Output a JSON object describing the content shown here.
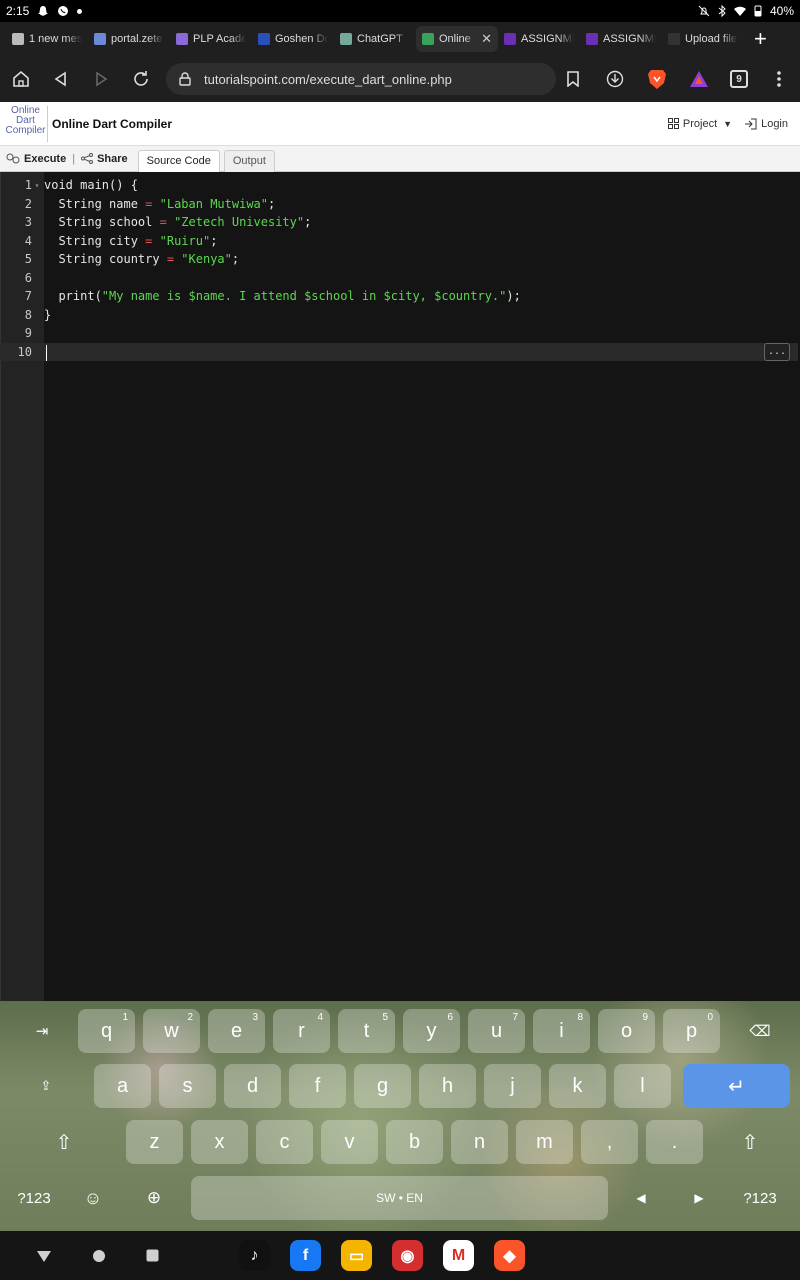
{
  "status_bar": {
    "time": "2:15",
    "battery": "40%"
  },
  "tabs": [
    {
      "title": "1 new mes",
      "fav_color": "#bbbbbb"
    },
    {
      "title": "portal.zete",
      "fav_color": "#6a8ad8"
    },
    {
      "title": "PLP Acade",
      "fav_color": "#8a6ad8"
    },
    {
      "title": "Goshen De",
      "fav_color": "#2b4fb8"
    },
    {
      "title": "ChatGPT",
      "fav_color": "#74aa9c"
    },
    {
      "title": "Online",
      "fav_color": "#3aa35a",
      "active": true
    },
    {
      "title": "ASSIGNME",
      "fav_color": "#6b2fb3"
    },
    {
      "title": "ASSIGNME",
      "fav_color": "#6b2fb3"
    },
    {
      "title": "Upload file",
      "fav_color": "#333333"
    }
  ],
  "toolbar": {
    "url": "tutorialspoint.com/execute_dart_online.php",
    "tab_count": "9"
  },
  "site": {
    "logo_alt": "Online Dart Compiler",
    "title": "Online Dart Compiler",
    "project_label": "Project",
    "login_label": "Login"
  },
  "editor_toolbar": {
    "execute_label": "Execute",
    "share_label": "Share",
    "source_code_tab": "Source Code",
    "output_tab": "Output"
  },
  "code": {
    "lines": [
      "void main() {",
      "  String name = \"Laban Mutwiwa\";",
      "  String school = \"Zetech Univesity\";",
      "  String city = \"Ruiru\";",
      "  String country = \"Kenya\";",
      "",
      "  print(\"My name is $name. I attend $school in $city, $country.\");",
      "}",
      "",
      ""
    ],
    "current_line": 10,
    "more_button": "..."
  },
  "keyboard": {
    "row1": [
      {
        "k": "q",
        "n": "1"
      },
      {
        "k": "w",
        "n": "2"
      },
      {
        "k": "e",
        "n": "3"
      },
      {
        "k": "r",
        "n": "4"
      },
      {
        "k": "t",
        "n": "5"
      },
      {
        "k": "y",
        "n": "6"
      },
      {
        "k": "u",
        "n": "7"
      },
      {
        "k": "i",
        "n": "8"
      },
      {
        "k": "o",
        "n": "9"
      },
      {
        "k": "p",
        "n": "0"
      }
    ],
    "row2": [
      "a",
      "s",
      "d",
      "f",
      "g",
      "h",
      "j",
      "k",
      "l"
    ],
    "row3": [
      "z",
      "x",
      "c",
      "v",
      "b",
      "n",
      "m",
      ",",
      "."
    ],
    "symbols_label": "?123",
    "space_label": "SW • EN"
  },
  "dock_apps": [
    {
      "name": "TikTok",
      "glyph": "♪",
      "color": "#111111"
    },
    {
      "name": "Facebook",
      "glyph": "f",
      "color": "#1877f2"
    },
    {
      "name": "Slides",
      "glyph": "▭",
      "color": "#f4b400"
    },
    {
      "name": "Manchester United",
      "glyph": "◉",
      "color": "#d32f2f"
    },
    {
      "name": "Gmail",
      "glyph": "M",
      "color": "#ffffff"
    },
    {
      "name": "Brave",
      "glyph": "◆",
      "color": "#fb542b"
    }
  ]
}
